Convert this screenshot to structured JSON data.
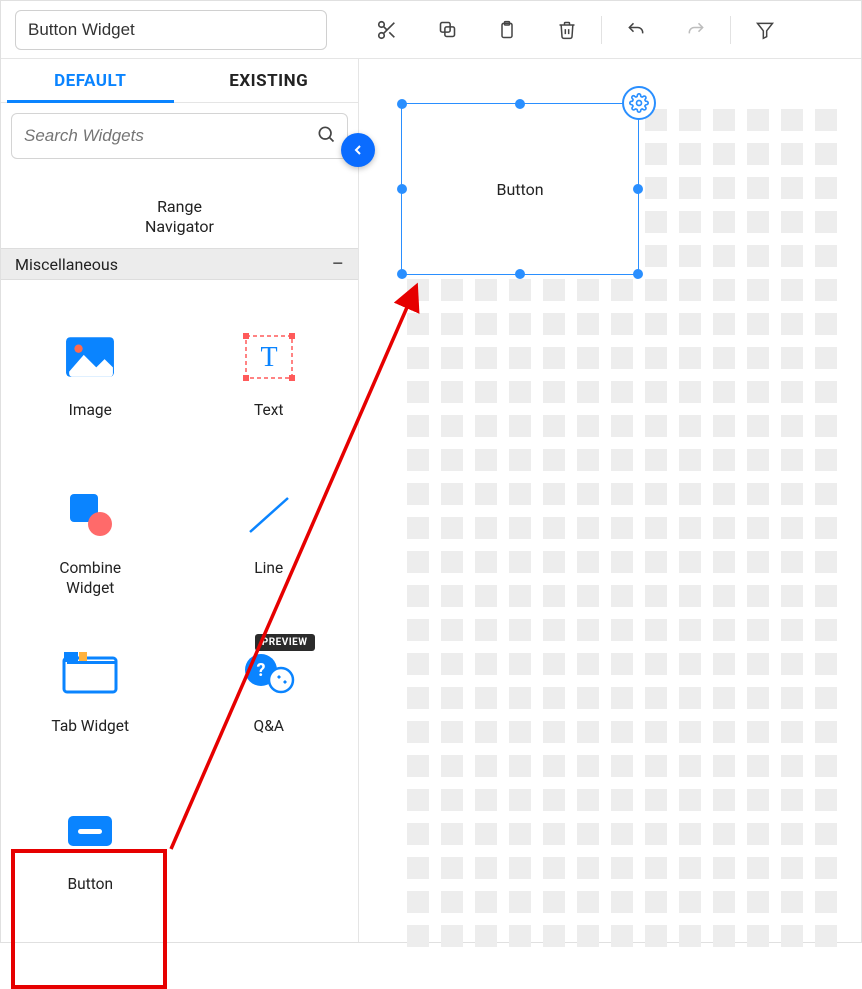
{
  "title": "Button Widget",
  "toolbar": {
    "cut": "cut",
    "copy": "copy",
    "paste": "paste",
    "delete": "delete",
    "undo": "undo",
    "redo": "redo",
    "filter": "filter"
  },
  "tabs": {
    "default": "DEFAULT",
    "existing": "EXISTING"
  },
  "search": {
    "placeholder": "Search Widgets"
  },
  "above_category_item": "Range Navigator",
  "category": {
    "title": "Miscellaneous"
  },
  "widgets": [
    {
      "id": "image",
      "label": "Image"
    },
    {
      "id": "text",
      "label": "Text"
    },
    {
      "id": "combine",
      "label": "Combine Widget"
    },
    {
      "id": "line",
      "label": "Line"
    },
    {
      "id": "tab",
      "label": "Tab Widget"
    },
    {
      "id": "qa",
      "label": "Q&A",
      "badge": "PREVIEW"
    },
    {
      "id": "button",
      "label": "Button",
      "highlighted": true
    }
  ],
  "canvas": {
    "placed_label": "Button"
  },
  "colors": {
    "accent": "#0a84ff",
    "selection": "#2a8fff",
    "annotation": "#e60000",
    "grid": "#ededed"
  }
}
